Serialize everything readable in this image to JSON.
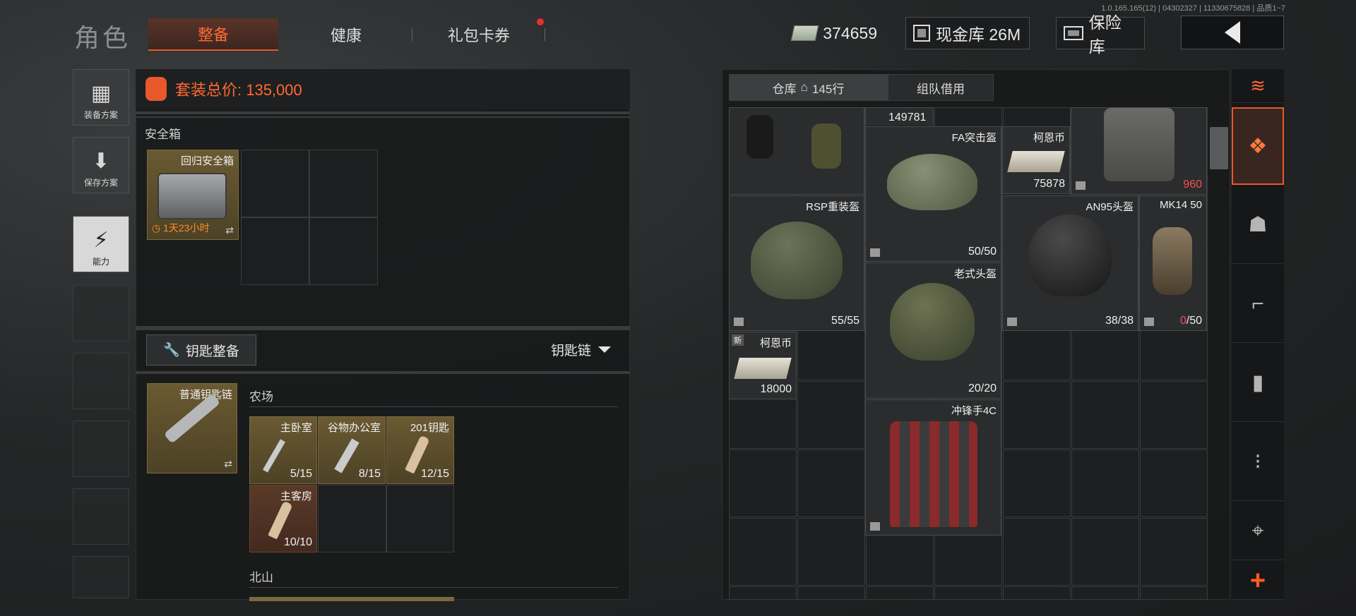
{
  "version": "1.0.165.165(12) | 04302327 | 11330675828 | 品质1~7",
  "header": {
    "title": "角色",
    "tabs": [
      {
        "label": "整备",
        "active": true
      },
      {
        "label": "健康",
        "active": false
      },
      {
        "label": "礼包卡券",
        "active": false,
        "notification": true
      }
    ],
    "cash": "374659",
    "cash_vault": "现金库 26M",
    "safe_vault": "保险库"
  },
  "side": {
    "loadout_plan": "装备方案",
    "save_plan": "保存方案",
    "ability": "能力"
  },
  "loadout": {
    "total_price": "套装总价: 135,000",
    "safebox_label": "安全箱",
    "safebox_item": {
      "name": "回归安全箱",
      "timer": "1天23小时"
    },
    "key_tab": "钥匙整备",
    "key_dropdown": "钥匙链",
    "keychain_item": "普通钥匙链",
    "sections": [
      {
        "name": "农场",
        "keys": [
          {
            "name": "主卧室",
            "count": "5/15"
          },
          {
            "name": "谷物办公室",
            "count": "8/15"
          },
          {
            "name": "201钥匙",
            "count": "12/15"
          },
          {
            "name": "主客房",
            "count": "10/10"
          }
        ]
      },
      {
        "name": "北山"
      }
    ]
  },
  "warehouse": {
    "tabs": [
      {
        "label": "仓库",
        "rows": "145行",
        "active": true
      },
      {
        "label": "组队借用",
        "active": false
      }
    ],
    "items": [
      {
        "name": "",
        "count": "149781"
      },
      {
        "name": "FA突击盔",
        "count": ""
      },
      {
        "name": "柯恩币",
        "count": "75878"
      },
      {
        "name": "",
        "count": "960"
      },
      {
        "name": "RSP重装盔",
        "count": "55/55"
      },
      {
        "name": "",
        "count": "50/50"
      },
      {
        "name": "AN95头盔",
        "count": "38/38"
      },
      {
        "name": "MK14 50",
        "count_zero": "0",
        "count_rest": "/50"
      },
      {
        "name": "老式头盔",
        "count": "20/20"
      },
      {
        "name": "柯恩币",
        "count": "18000",
        "new": "新"
      },
      {
        "name": "冲锋手4C",
        "count": ""
      }
    ]
  },
  "colors": {
    "accent": "#e8582a",
    "accent_text": "#ff6a33",
    "red_count": "#ff4d4d"
  }
}
